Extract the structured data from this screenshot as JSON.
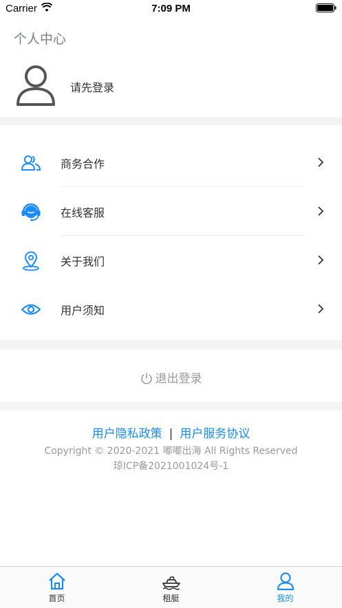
{
  "statusbar": {
    "carrier": "Carrier",
    "time": "7:09 PM"
  },
  "page": {
    "title": "个人中心"
  },
  "profile": {
    "login_prompt": "请先登录"
  },
  "menu": [
    {
      "label": "商务合作",
      "icon": "people-icon"
    },
    {
      "label": "在线客服",
      "icon": "headset-icon"
    },
    {
      "label": "关于我们",
      "icon": "location-pin-icon"
    },
    {
      "label": "用户须知",
      "icon": "eye-icon"
    }
  ],
  "logout": {
    "label": "退出登录"
  },
  "footer": {
    "privacy_label": "用户隐私政策",
    "separator": "|",
    "service_label": "用户服务协议",
    "copyright": "Copyright © 2020-2021 嘟嘟出海 All Rights Reserved",
    "icp": "琼ICP备2021001024号-1"
  },
  "tabs": [
    {
      "label": "首页",
      "icon": "home-icon",
      "active": false
    },
    {
      "label": "租艇",
      "icon": "yacht-icon",
      "active": false
    },
    {
      "label": "我的",
      "icon": "user-icon",
      "active": true
    }
  ],
  "colors": {
    "accent": "#1a8cff",
    "inactive": "#333333",
    "muted": "#9a9a9a",
    "separator": "#f4f4f4"
  }
}
